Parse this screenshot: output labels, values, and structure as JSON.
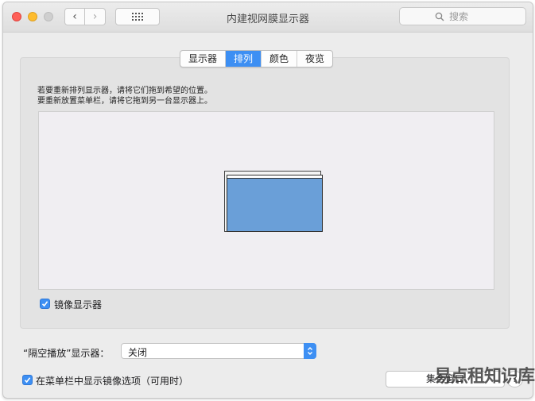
{
  "window": {
    "title": "内建视网膜显示器"
  },
  "toolbar": {
    "back_symbol": "‹",
    "forward_symbol": "›",
    "search_placeholder": "搜索"
  },
  "tabs": [
    {
      "label": "显示器",
      "active": false
    },
    {
      "label": "排列",
      "active": true
    },
    {
      "label": "颜色",
      "active": false
    },
    {
      "label": "夜览",
      "active": false
    }
  ],
  "arrangement": {
    "instruction_line1": "若要重新排列显示器，请将它们拖到希望的位置。",
    "instruction_line2": "要重新放置菜单栏，请将它拖到另一台显示器上。",
    "mirror_displays_label": "镜像显示器",
    "mirror_displays_checked": true
  },
  "airplay": {
    "label": "“隔空播放”显示器：",
    "selected_value": "关闭"
  },
  "menubar_option": {
    "label": "在菜单栏中显示镜像选项（可用时）",
    "checked": true
  },
  "gather_button_label": "集合窗口",
  "help_symbol": "?",
  "watermark_text": "易点租知识库",
  "colors": {
    "accent": "#3d8ff3",
    "display_fill": "#6a9fd8",
    "close": "#fe5f57",
    "minimize": "#febc2e"
  },
  "icons": [
    "grid-icon",
    "search-icon",
    "checkmark-icon",
    "chevron-updown-icon"
  ]
}
